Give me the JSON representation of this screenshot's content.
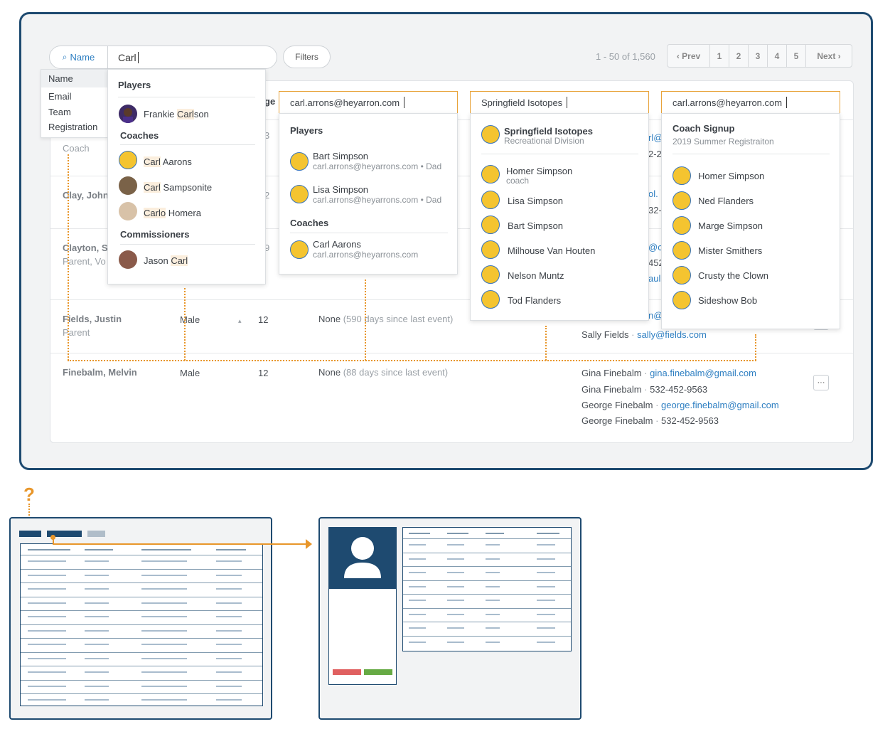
{
  "search": {
    "type_label": "Name",
    "value": "Carl",
    "filters_label": "Filters"
  },
  "type_menu": {
    "items": [
      "Name",
      "Email",
      "Team",
      "Registration"
    ]
  },
  "pagination": {
    "range": "1 - 50  of 1,560",
    "prev": "Prev",
    "pages": [
      "1",
      "2",
      "3",
      "4",
      "5"
    ],
    "next": "Next"
  },
  "table": {
    "header_partial": "ge",
    "rows": [
      {
        "role": "Coach",
        "age_partial": "3"
      },
      {
        "name": "Clay, John",
        "age_partial": "2"
      },
      {
        "name": "Clayton, S",
        "role": "Parent, Vo",
        "age_partial": "9"
      },
      {
        "name": "Fields, Justin",
        "role": "Parent",
        "gender": "Male",
        "age": "12",
        "event": "None",
        "event_detail": "(590 days since last event)"
      },
      {
        "name": "Finebalm, Melvin",
        "gender": "Male",
        "age": "12",
        "event": "None",
        "event_detail": "(88 days since last event)"
      }
    ],
    "contacts_partial": [
      "rl@",
      "2-2",
      "ol.",
      "32-",
      "@cl",
      "452",
      "aul",
      "n@f"
    ],
    "fields_contact": {
      "name": "Sally Fields",
      "email": "sally@fields.com"
    },
    "finebalm_contacts": [
      {
        "name": "Gina Finebalm",
        "value": "gina.finebalm@gmail.com",
        "is_link": true
      },
      {
        "name": "Gina Finebalm",
        "value": "532-452-9563",
        "is_link": false
      },
      {
        "name": "George Finebalm",
        "value": "george.finebalm@gmail.com",
        "is_link": true
      },
      {
        "name": "George Finebalm",
        "value": "532-452-9563",
        "is_link": false
      }
    ],
    "more_label": "···"
  },
  "name_dropdown": {
    "players_head": "Players",
    "players": [
      {
        "pre": "Frankie ",
        "hl": "Carl",
        "post": "son"
      }
    ],
    "coaches_head": "Coaches",
    "coaches": [
      {
        "pre": "",
        "hl": "Carl",
        "post": " Aarons"
      },
      {
        "pre": "",
        "hl": "Carl",
        "post": " Sampsonite"
      },
      {
        "pre": "",
        "hl": "Carlo",
        "post": " Homera"
      }
    ],
    "commissioners_head": "Commissioners",
    "commissioners": [
      {
        "pre": "Jason ",
        "hl": "Carl",
        "post": ""
      }
    ]
  },
  "email_dropdown": {
    "field": "carl.arrons@heyarron.com",
    "players_head": "Players",
    "players": [
      {
        "name": "Bart Simpson",
        "sub": "carl.arrons@heyarrons.com • Dad"
      },
      {
        "name": "Lisa Simpson",
        "sub": "carl.arrons@heyarrons.com • Dad"
      }
    ],
    "coaches_head": "Coaches",
    "coaches": [
      {
        "name": "Carl Aarons",
        "sub": "carl.arrons@heyarrons.com"
      }
    ]
  },
  "team_dropdown": {
    "field": "Springfield Isotopes",
    "team": {
      "name": "Springfield Isotopes",
      "division": "Recreational Division"
    },
    "members": [
      {
        "name": "Homer Simpson",
        "sub": "coach"
      },
      {
        "name": "Lisa Simpson"
      },
      {
        "name": "Bart Simpson"
      },
      {
        "name": "Milhouse Van Houten"
      },
      {
        "name": "Nelson Muntz"
      },
      {
        "name": "Tod Flanders"
      }
    ]
  },
  "reg_dropdown": {
    "field": "carl.arrons@heyarron.com",
    "head": "Coach Signup",
    "sub": "2019 Summer Registraiton",
    "members": [
      "Homer Simpson",
      "Ned Flanders",
      "Marge Simpson",
      "Mister Smithers",
      "Crusty the Clown",
      "Sideshow Bob"
    ]
  },
  "annotation": {
    "question": "?"
  },
  "colors": {
    "navy": "#1e4a70",
    "orange": "#e8962a",
    "link": "#2e7fc2",
    "highlight": "#fbeedd"
  }
}
